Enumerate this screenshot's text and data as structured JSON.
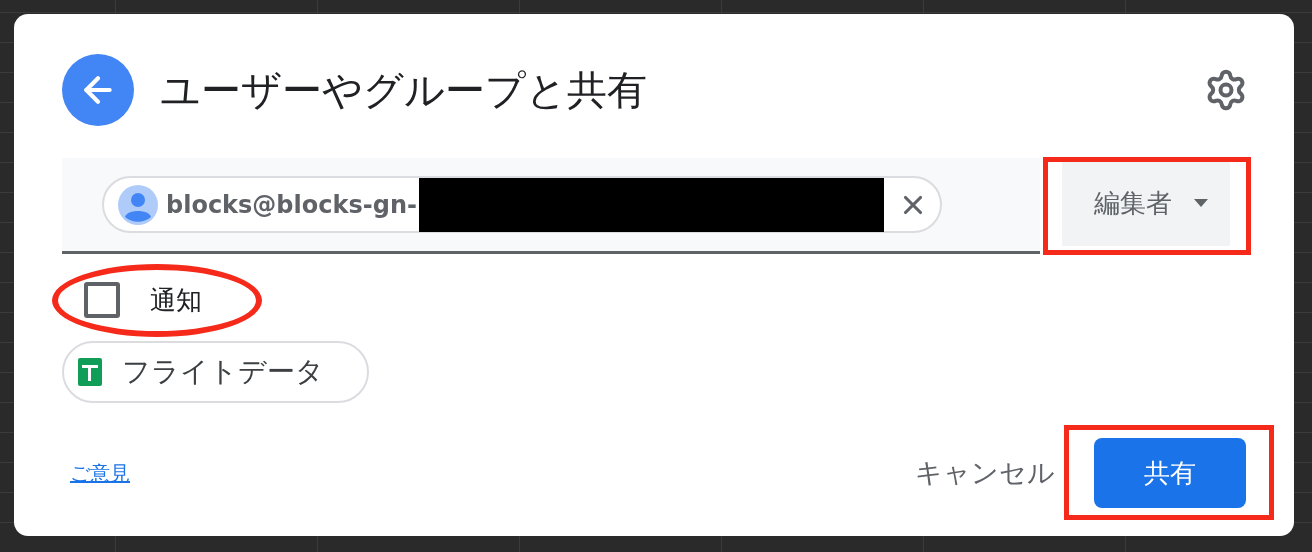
{
  "dialog": {
    "title": "ユーザーやグループと共有"
  },
  "recipient": {
    "email": "blocks@blocks-gn-",
    "redacted": true
  },
  "role": {
    "label": "編集者",
    "highlighted": true
  },
  "notify": {
    "label": "通知",
    "checked": false,
    "highlighted": true
  },
  "attachment": {
    "name": "フライトデータ"
  },
  "footer": {
    "feedback": "ご意見",
    "cancel": "キャンセル",
    "share": "共有",
    "share_highlighted": true
  }
}
